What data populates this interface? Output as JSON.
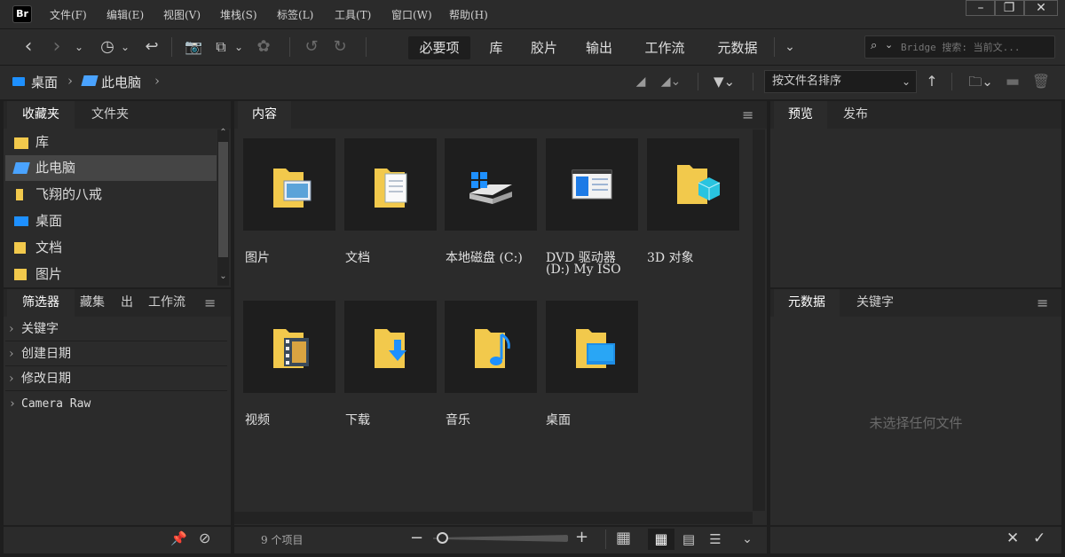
{
  "app": {
    "logo": "Br"
  },
  "menu": [
    "文件(F)",
    "编辑(E)",
    "视图(V)",
    "堆栈(S)",
    "标签(L)",
    "工具(T)",
    "窗口(W)",
    "帮助(H)"
  ],
  "window_controls": [
    "minimize-icon",
    "restore-icon",
    "close-icon"
  ],
  "workspaces": [
    "必要项",
    "库",
    "胶片",
    "输出",
    "工作流",
    "元数据"
  ],
  "active_workspace": "必要项",
  "search": {
    "placeholder": "Bridge 搜索: 当前文..."
  },
  "breadcrumb": [
    "桌面",
    "此电脑"
  ],
  "sort": {
    "label": "按文件名排序"
  },
  "left_panel": {
    "tabs": [
      "收藏夹",
      "文件夹"
    ],
    "favorites": [
      {
        "label": "库",
        "icon": "library-folder-icon"
      },
      {
        "label": "此电脑",
        "icon": "computer-icon",
        "selected": true
      },
      {
        "label": "飞翔的八戒",
        "icon": "user-folder-icon"
      },
      {
        "label": "桌面",
        "icon": "desktop-icon"
      },
      {
        "label": "文档",
        "icon": "documents-icon"
      },
      {
        "label": "图片",
        "icon": "pictures-icon"
      }
    ],
    "lower_tabs": [
      "筛选器",
      "藏集",
      "出",
      "工作流"
    ],
    "filters": [
      "关键字",
      "创建日期",
      "修改日期",
      "Camera Raw"
    ]
  },
  "content": {
    "tab": "内容",
    "items": [
      {
        "label": "图片",
        "icon": "pictures-folder-icon"
      },
      {
        "label": "文档",
        "icon": "documents-folder-icon"
      },
      {
        "label": "本地磁盘 (C:)",
        "icon": "local-disk-icon"
      },
      {
        "label": "DVD 驱动器 (D:) My ISO",
        "icon": "dvd-drive-icon"
      },
      {
        "label": "3D 对象",
        "icon": "3d-objects-folder-icon"
      },
      {
        "label": "视频",
        "icon": "videos-folder-icon"
      },
      {
        "label": "下载",
        "icon": "downloads-folder-icon"
      },
      {
        "label": "音乐",
        "icon": "music-folder-icon"
      },
      {
        "label": "桌面",
        "icon": "desktop-folder-icon"
      }
    ],
    "status": "9 个项目"
  },
  "right_panel": {
    "top_tabs": [
      "预览",
      "发布"
    ],
    "bottom_tabs": [
      "元数据",
      "关键字"
    ],
    "empty_message": "未选择任何文件"
  },
  "colors": {
    "panel_bg": "#2b2b2b",
    "app_bg": "#1e1e1e",
    "folder_yellow": "#f2c94c",
    "accent_blue": "#1e90ff"
  }
}
